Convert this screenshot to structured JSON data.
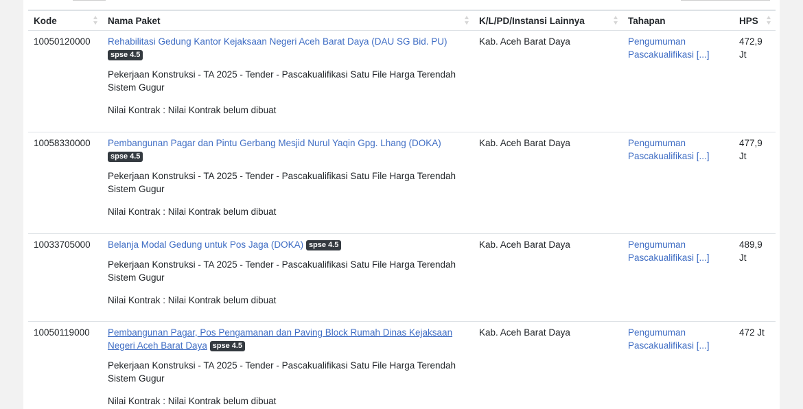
{
  "table": {
    "headers": {
      "kode": "Kode",
      "nama": "Nama Paket",
      "instansi": "K/L/PD/Instansi Lainnya",
      "tahapan": "Tahapan",
      "hps": "HPS"
    },
    "rows": [
      {
        "kode": "10050120000",
        "nama": "Rehabilitasi Gedung Kantor Kejaksaan Negeri Aceh Barat Daya (DAU SG Bid. PU)",
        "badge": "spse 4.5",
        "detail": "Pekerjaan Konstruksi - TA 2025 - Tender - Pascakualifikasi Satu File Harga Terendah Sistem Gugur",
        "nilai": "Nilai Kontrak : Nilai Kontrak belum dibuat",
        "instansi": "Kab. Aceh Barat Daya",
        "tahapan": "Pengumuman Pascakualifikasi [...]",
        "hps": "472,9 Jt"
      },
      {
        "kode": "10058330000",
        "nama": "Pembangunan Pagar dan Pintu Gerbang Mesjid Nurul Yaqin Gpg. Lhang (DOKA)",
        "badge": "spse 4.5",
        "detail": "Pekerjaan Konstruksi - TA 2025 - Tender - Pascakualifikasi Satu File Harga Terendah Sistem Gugur",
        "nilai": "Nilai Kontrak : Nilai Kontrak belum dibuat",
        "instansi": "Kab. Aceh Barat Daya",
        "tahapan": "Pengumuman Pascakualifikasi [...]",
        "hps": "477,9 Jt"
      },
      {
        "kode": "10033705000",
        "nama": "Belanja Modal Gedung untuk Pos Jaga (DOKA)",
        "badge": "spse 4.5",
        "detail": "Pekerjaan Konstruksi - TA 2025 - Tender - Pascakualifikasi Satu File Harga Terendah Sistem Gugur",
        "nilai": "Nilai Kontrak : Nilai Kontrak belum dibuat",
        "instansi": "Kab. Aceh Barat Daya",
        "tahapan": "Pengumuman Pascakualifikasi [...]",
        "hps": "489,9 Jt"
      },
      {
        "kode": "10050119000",
        "nama": "Pembangunan Pagar, Pos Pengamanan dan Paving Block Rumah Dinas Kejaksaan Negeri Aceh Barat Daya",
        "badge": "spse 4.5",
        "detail": "Pekerjaan Konstruksi - TA 2025 - Tender - Pascakualifikasi Satu File Harga Terendah Sistem Gugur",
        "nilai": "Nilai Kontrak : Nilai Kontrak belum dibuat",
        "instansi": "Kab. Aceh Barat Daya",
        "tahapan": "Pengumuman Pascakualifikasi [...]",
        "hps": "472 Jt"
      }
    ]
  },
  "colors": {
    "link": "#3f6dc4",
    "badge_bg": "#343a40",
    "page_bg": "#f2f2f2"
  }
}
